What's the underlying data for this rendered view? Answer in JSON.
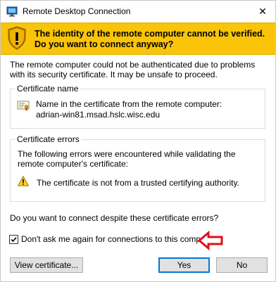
{
  "window": {
    "title": "Remote Desktop Connection",
    "close_glyph": "✕"
  },
  "banner": {
    "heading": "The identity of the remote computer cannot be verified. Do you want to connect anyway?",
    "background": "#f9c409"
  },
  "intro": "The remote computer could not be authenticated due to problems with its security certificate. It may be unsafe to proceed.",
  "certificate_name": {
    "label": "Certificate name",
    "description": "Name in the certificate from the remote computer:",
    "value": "adrian-win81.msad.hslc.wisc.edu"
  },
  "certificate_errors": {
    "label": "Certificate errors",
    "description": "The following errors were encountered while validating the remote computer's certificate:",
    "errors": [
      "The certificate is not from a trusted certifying authority."
    ]
  },
  "question": "Do you want to connect despite these certificate errors?",
  "dont_ask_checkbox": {
    "label": "Don't ask me again for connections to this computer",
    "checked": true
  },
  "buttons": {
    "view_certificate": "View certificate...",
    "yes": "Yes",
    "no": "No"
  },
  "annotation_color": "#e0101a"
}
